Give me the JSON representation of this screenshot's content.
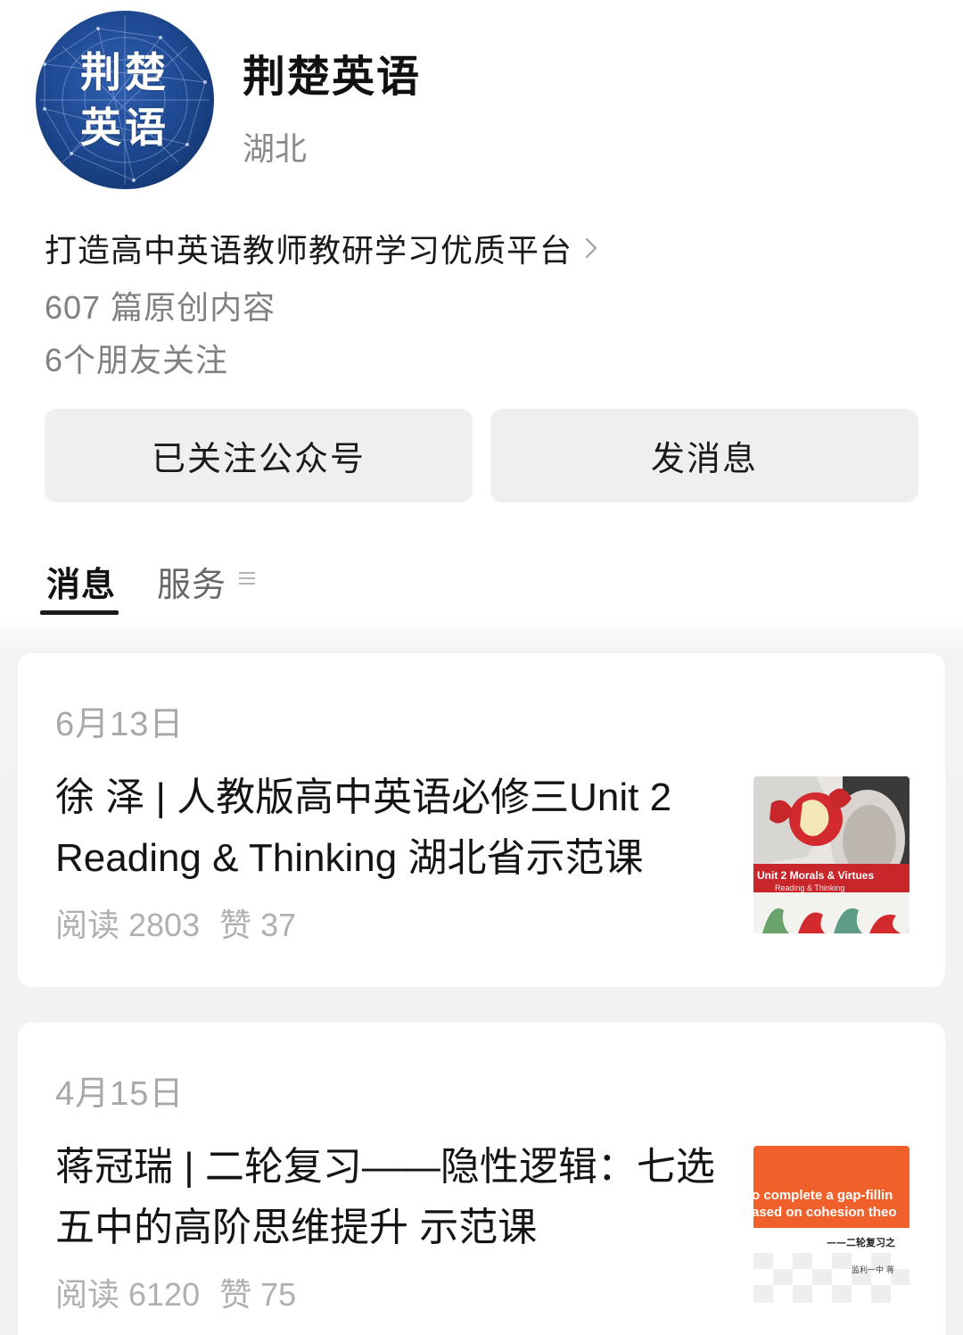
{
  "account": {
    "name": "荆楚英语",
    "region": "湖北",
    "avatar_text_line1": "荆楚",
    "avatar_text_line2": "英语",
    "intro": "打造高中英语教师教研学习优质平台",
    "originals": "607 篇原创内容",
    "friends_following": "6个朋友关注"
  },
  "buttons": {
    "follow": "已关注公众号",
    "message": "发消息"
  },
  "tabs": {
    "messages": "消息",
    "services": "服务"
  },
  "articles": [
    {
      "date": "6月13日",
      "title": "徐 泽 | 人教版高中英语必修三Unit 2 Reading & Thinking 湖北省示范课",
      "reads": "阅读 2803",
      "likes": "赞 37",
      "thumb_line1": "Unit 2 Morals & Virtues",
      "thumb_line2": "Reading & Thinking"
    },
    {
      "date": "4月15日",
      "title": "蒋冠瑞 | 二轮复习——隐性逻辑：七选五中的高阶思维提升 示范课",
      "reads": "阅读 6120",
      "likes": "赞 75",
      "thumb_line1": "o complete a gap-fillin",
      "thumb_line2": "ased on cohesion theo",
      "thumb_line3": "——二轮复习之",
      "thumb_line4": "监利一中  蒋"
    }
  ],
  "colors": {
    "button_bg": "#efefef",
    "avatar_blue": "#1f4a94",
    "thumb2_orange": "#f0602a",
    "thumb1_red": "#c8262b"
  }
}
